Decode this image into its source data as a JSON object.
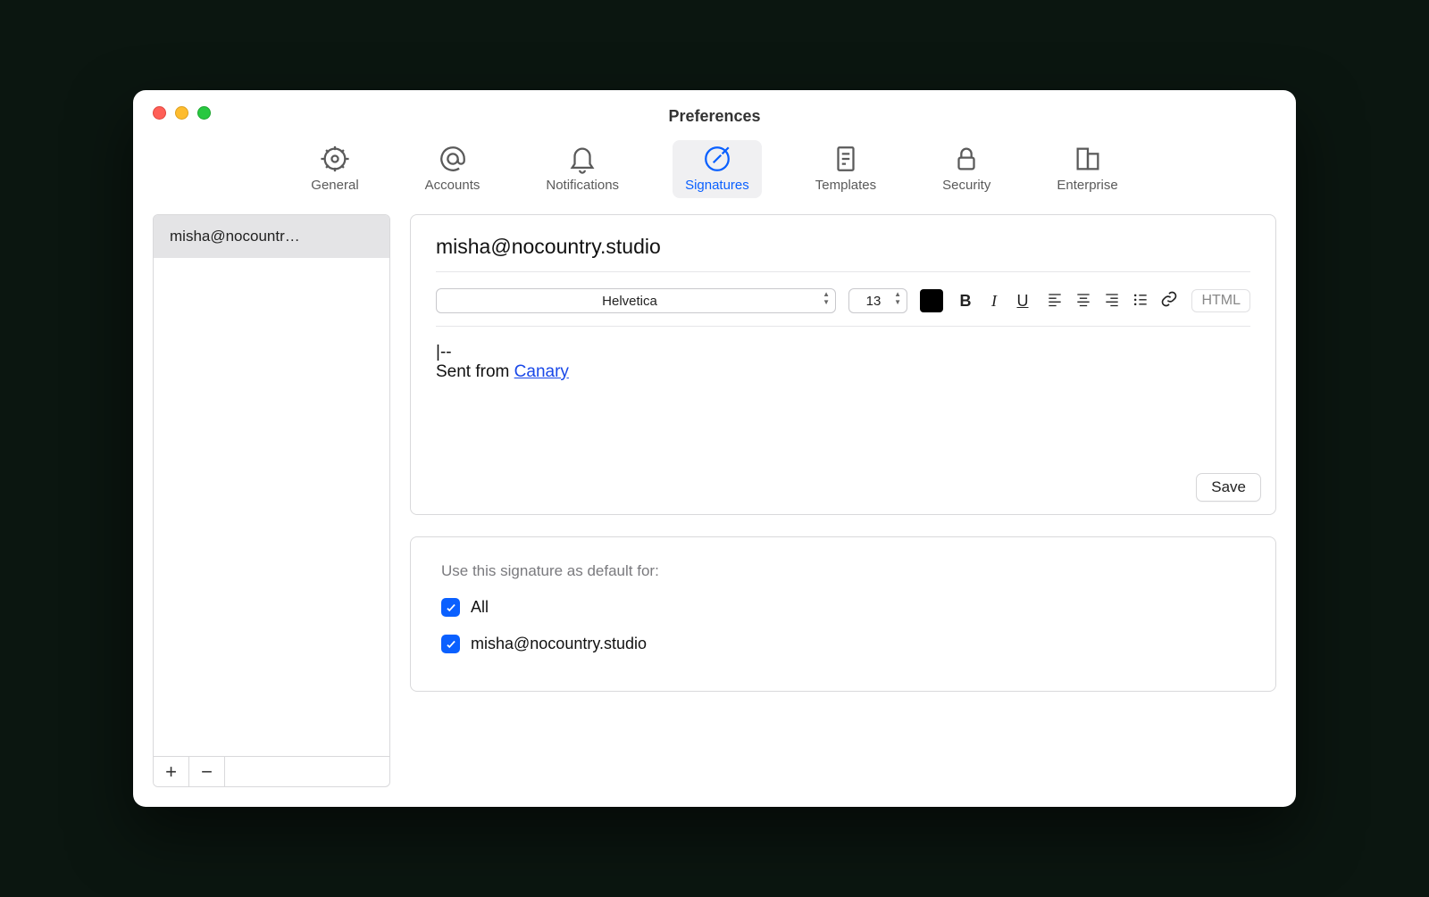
{
  "window": {
    "title": "Preferences"
  },
  "tabs": {
    "general": "General",
    "accounts": "Accounts",
    "notifications": "Notifications",
    "signatures": "Signatures",
    "templates": "Templates",
    "security": "Security",
    "enterprise": "Enterprise"
  },
  "sidebar": {
    "items": [
      {
        "label": "misha@nocountr…"
      }
    ],
    "add_label": "+",
    "remove_label": "−"
  },
  "editor": {
    "account": "misha@nocountry.studio",
    "font": "Helvetica",
    "size": "13",
    "signature_prefix": "--",
    "signature_text": "Sent from ",
    "signature_link_text": "Canary",
    "save_label": "Save",
    "html_label": "HTML"
  },
  "defaults": {
    "label": "Use this signature as default for:",
    "items": [
      {
        "label": "All",
        "checked": true
      },
      {
        "label": "misha@nocountry.studio",
        "checked": true
      }
    ]
  }
}
